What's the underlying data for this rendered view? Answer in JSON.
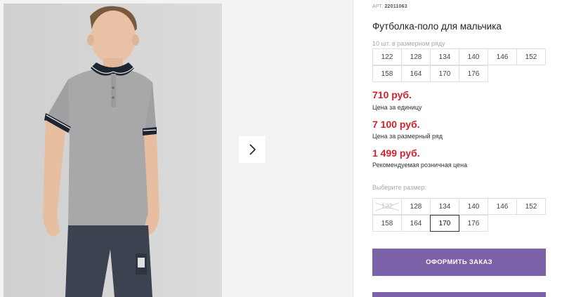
{
  "gallery": {
    "photo_alt": "",
    "next_icon": "chevron-right-icon"
  },
  "product": {
    "art_label": "АРТ.",
    "art_number": "22011063",
    "title": "Футболка-поло для мальчика",
    "range_note": "10 шт. в размерном ряду",
    "range_sizes": [
      [
        "122",
        "128",
        "134",
        "140",
        "146",
        "152"
      ],
      [
        "158",
        "164",
        "170",
        "176"
      ]
    ],
    "price_unit": "710 руб.",
    "price_unit_label": "Цена за единицу",
    "price_range": "7 100 руб.",
    "price_range_label": "Цена за размерный ряд",
    "price_retail": "1 499 руб.",
    "price_retail_label": "Рекомендуемая розничная цена",
    "choose_label": "Выберите размер:",
    "select_sizes": [
      [
        {
          "v": "122",
          "state": "disabled"
        },
        {
          "v": "128",
          "state": "available"
        },
        {
          "v": "134",
          "state": "available"
        },
        {
          "v": "140",
          "state": "available"
        },
        {
          "v": "146",
          "state": "available"
        },
        {
          "v": "152",
          "state": "available"
        }
      ],
      [
        {
          "v": "158",
          "state": "available"
        },
        {
          "v": "164",
          "state": "available"
        },
        {
          "v": "170",
          "state": "selected"
        },
        {
          "v": "176",
          "state": "available"
        }
      ]
    ],
    "order_button": "ОФОРМИТЬ ЗАКАЗ"
  },
  "colors": {
    "accent": "#7a61a8",
    "price": "#d2222d"
  }
}
